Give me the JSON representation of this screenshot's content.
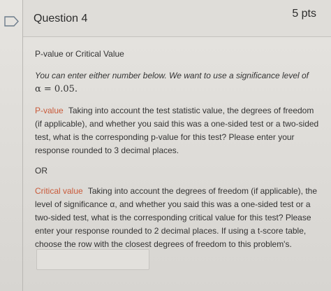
{
  "question": {
    "title": "Question 4",
    "points": "5 pts"
  },
  "content": {
    "heading": "P-value or Critical Value",
    "instruction": "You can enter either number below.  We want to use a significance level of",
    "alpha": "α = 0.05.",
    "pvalue_label": "P-value",
    "pvalue_text": "Taking into account the test statistic value, the degrees of freedom (if applicable), and whether you said this was a one-sided test or a two-sided test, what is the corresponding p-value for this test?  Please enter your response rounded to 3 decimal places.",
    "or": "OR",
    "critical_label": "Critical value",
    "critical_text": "Taking into account the degrees of freedom (if applicable), the level of significance α, and whether you said this was a one-sided test or a two-sided test, what is the corresponding critical value for this test? Please enter your response rounded to 2 decimal places.  If using a t-score table, choose the row with the closest degrees of freedom to this problem's."
  },
  "answer": {
    "value": ""
  }
}
